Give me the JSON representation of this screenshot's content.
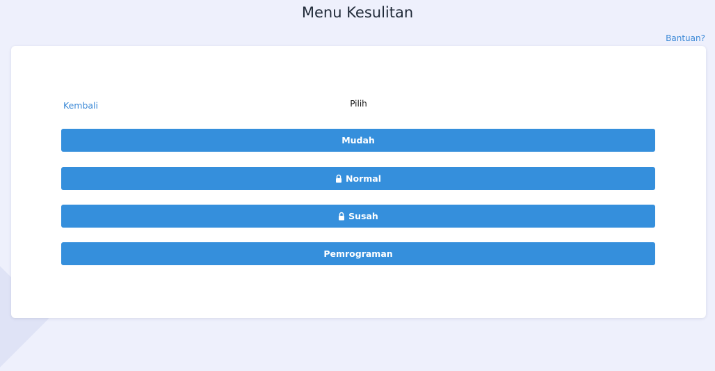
{
  "header": {
    "title": "Menu Kesulitan",
    "help_label": "Bantuan?"
  },
  "card": {
    "back_label": "Kembali",
    "choose_label": "Pilih",
    "options": [
      {
        "label": "Mudah",
        "locked": false
      },
      {
        "label": "Normal",
        "locked": true,
        "icon": "lock-icon"
      },
      {
        "label": "Susah",
        "locked": true,
        "icon": "lock-icon"
      },
      {
        "label": "Pemrograman",
        "locked": false
      }
    ]
  },
  "colors": {
    "background": "#eef0fc",
    "card": "#ffffff",
    "button": "#358fdc",
    "link": "#3a88d6",
    "title": "#1f2937"
  }
}
